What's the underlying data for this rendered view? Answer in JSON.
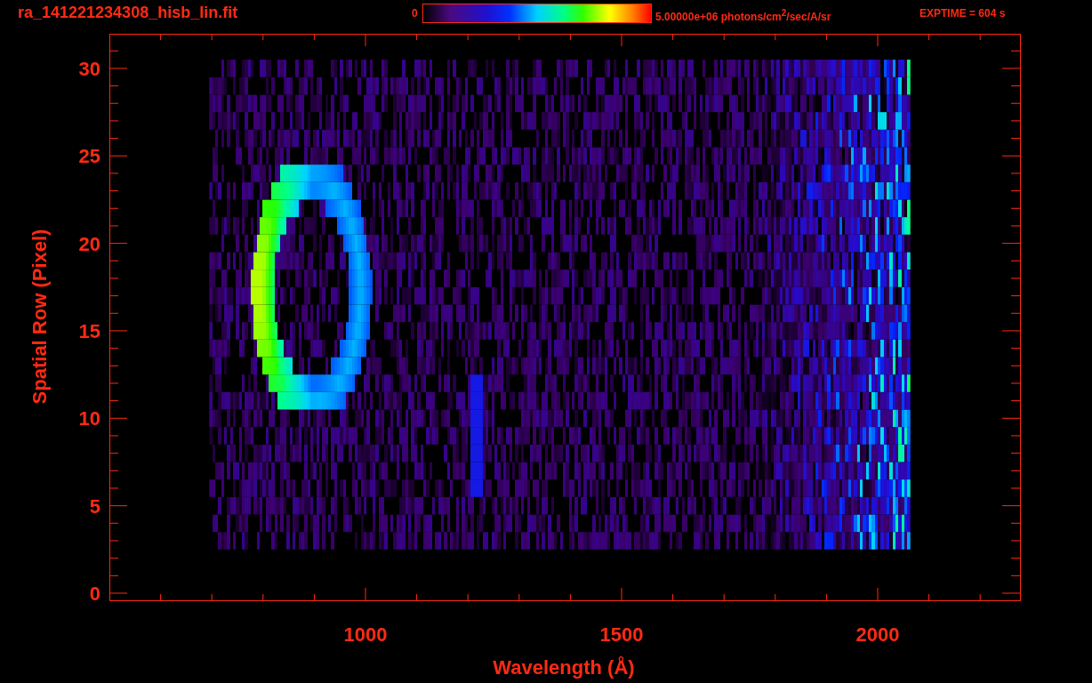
{
  "title": "ra_141221234308_hisb_lin.fit",
  "colorbar": {
    "min_label": "0",
    "max_label": "5.00000e+06 photons/cm$^{2}$/sec/A/sr"
  },
  "exposure": "EXPTIME = 604 s",
  "plot": {
    "xlabel": "Wavelength (Å)",
    "ylabel": "Spatial Row (Pixel)",
    "yticks": [
      "30",
      "25",
      "20",
      "15",
      "10",
      "5",
      "0"
    ],
    "xticks": [
      "1000",
      "1500",
      "2000"
    ]
  }
}
